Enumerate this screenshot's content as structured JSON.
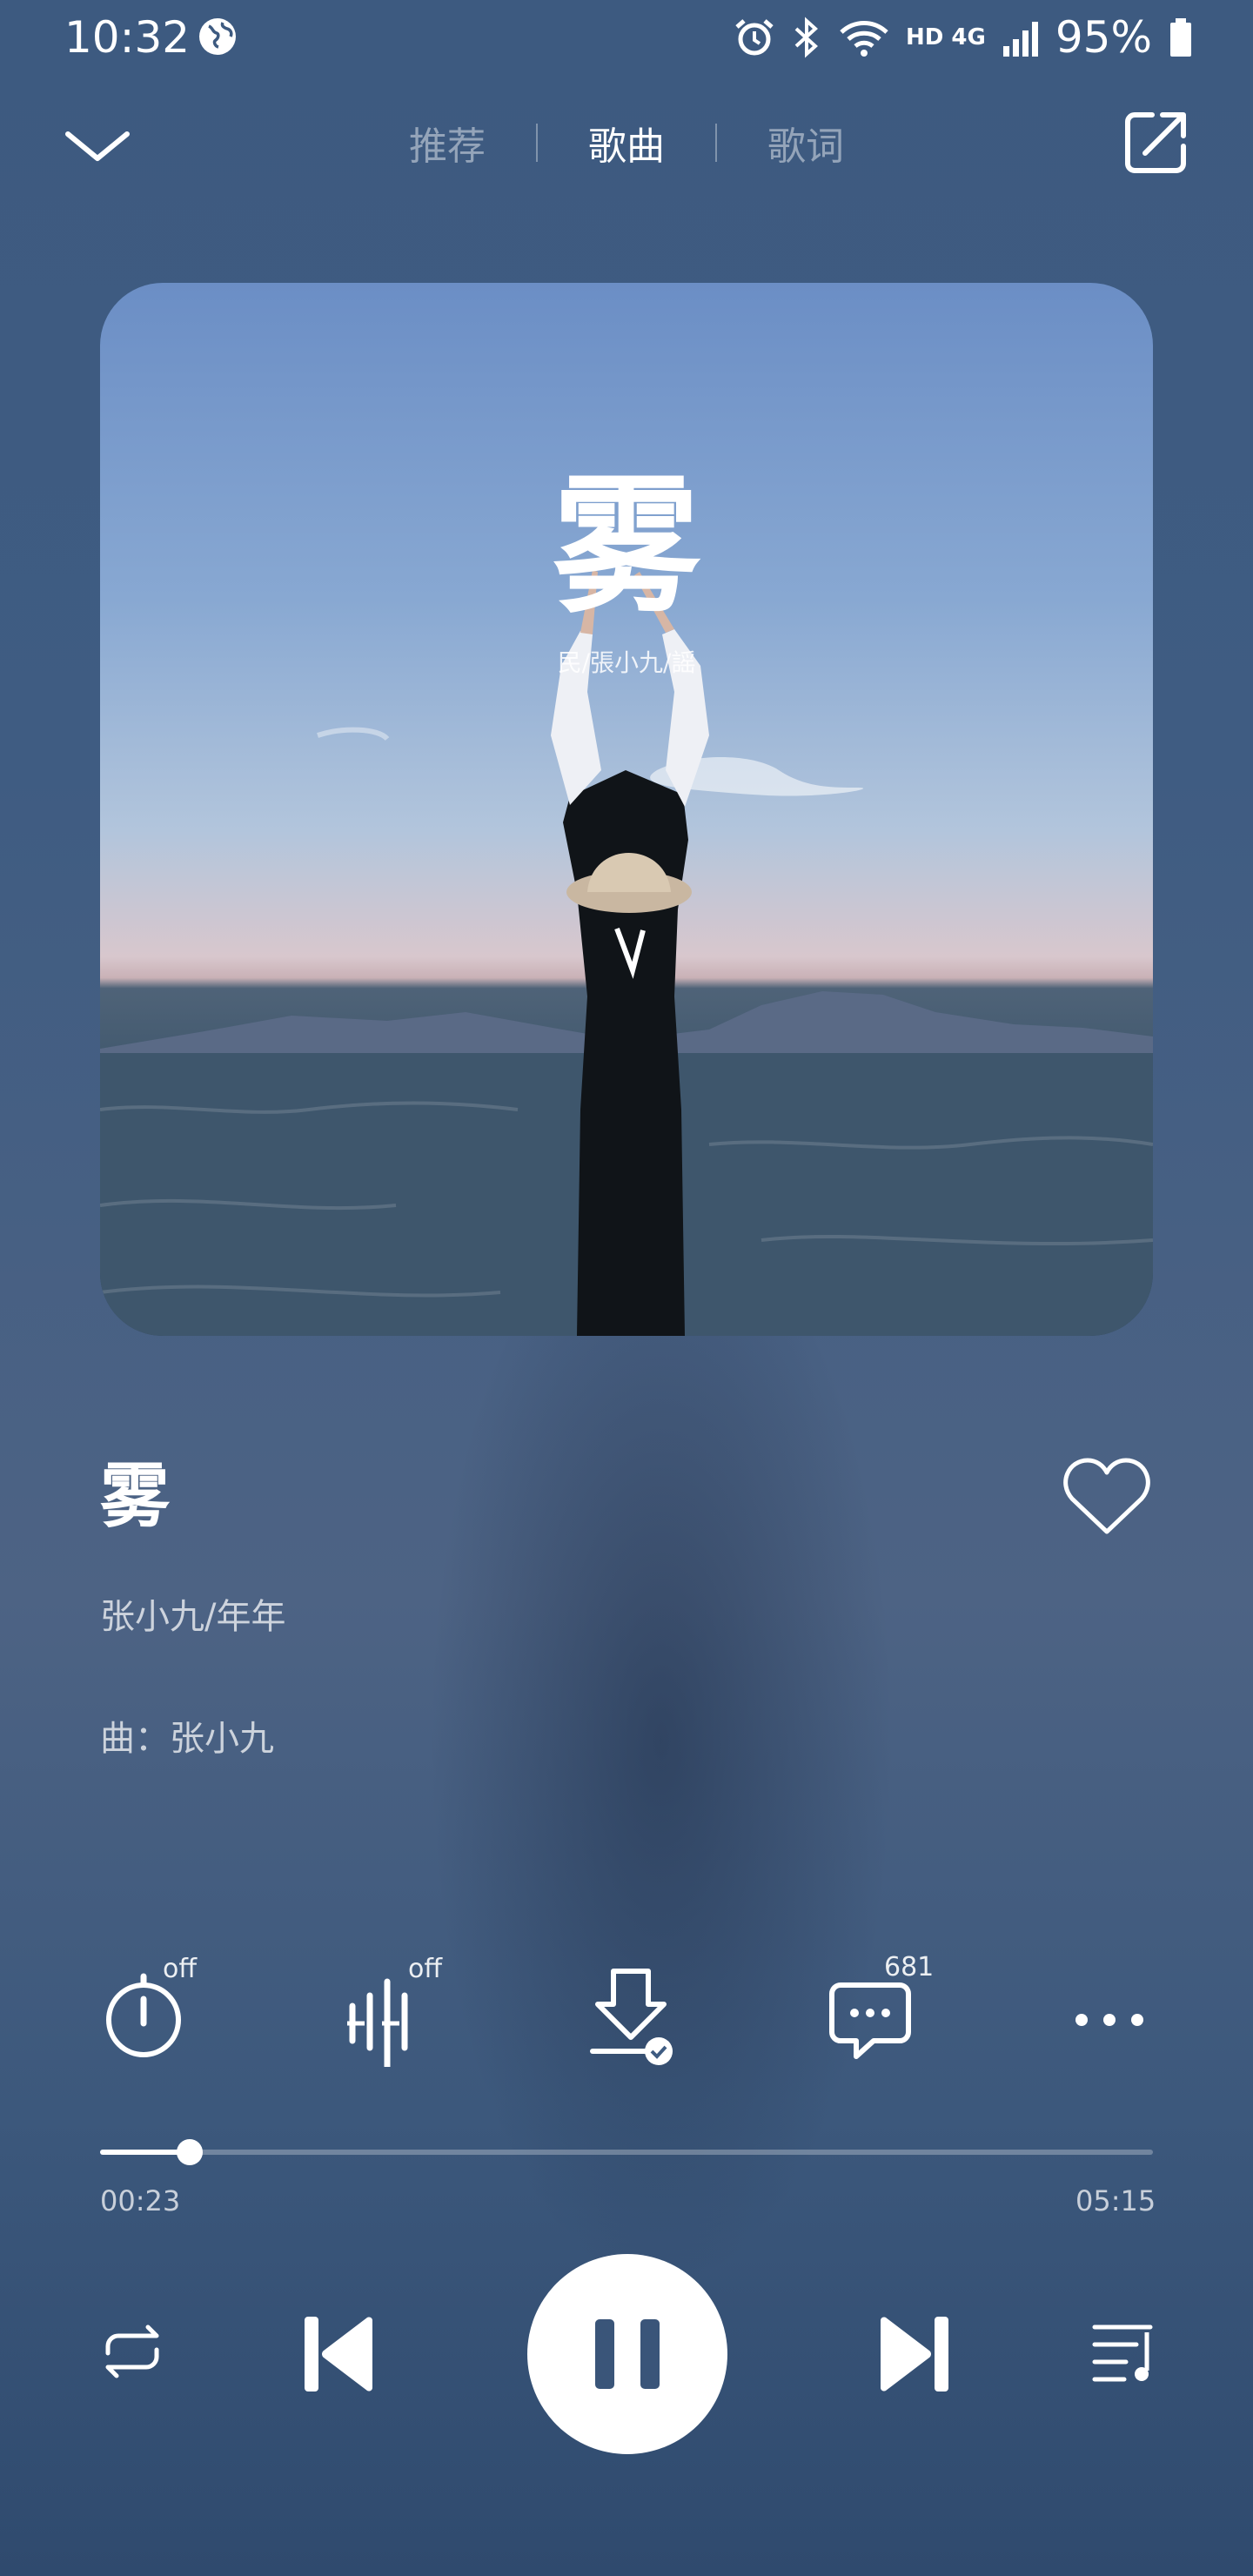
{
  "status_bar": {
    "time": "10:32",
    "network": "HD 4G",
    "battery": "95%"
  },
  "tabs": [
    {
      "label": "推荐",
      "active": false
    },
    {
      "label": "歌曲",
      "active": true
    },
    {
      "label": "歌词",
      "active": false
    }
  ],
  "album": {
    "title_char": "雾",
    "subtitle": "民/張小九/謡"
  },
  "song": {
    "title": "雾",
    "artist": "张小九/年年",
    "composer": "曲：张小九",
    "liked": false
  },
  "toolbar": {
    "sleep_timer": "off",
    "sound_effect": "off",
    "download_state": "downloaded",
    "comment_count": "681"
  },
  "playback": {
    "current_time": "00:23",
    "total_time": "05:15",
    "progress_fraction": 0.085,
    "state": "playing"
  },
  "colors": {
    "accent": "#ffffff",
    "background_top": "#3d5a80",
    "background_bottom": "#2f4a6e"
  }
}
